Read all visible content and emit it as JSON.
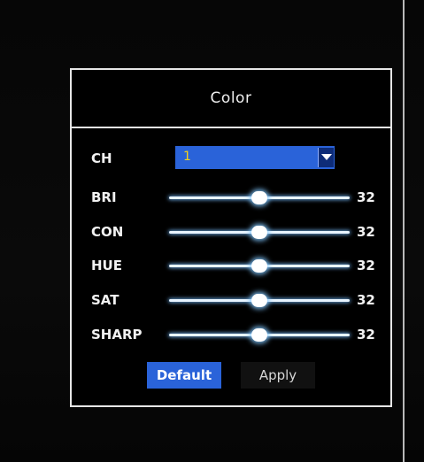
{
  "dialog": {
    "title": "Color"
  },
  "channel": {
    "label": "CH",
    "value": "1"
  },
  "sliders": [
    {
      "label": "BRI",
      "value": "32",
      "level": 0.5
    },
    {
      "label": "CON",
      "value": "32",
      "level": 0.5
    },
    {
      "label": "HUE",
      "value": "32",
      "level": 0.5
    },
    {
      "label": "SAT",
      "value": "32",
      "level": 0.5
    },
    {
      "label": "SHARP",
      "value": "32",
      "level": 0.5
    }
  ],
  "buttons": {
    "default_label": "Default",
    "apply_label": "Apply"
  },
  "colors": {
    "accent": "#2a63d9",
    "channel_value": "#f4d21a"
  }
}
